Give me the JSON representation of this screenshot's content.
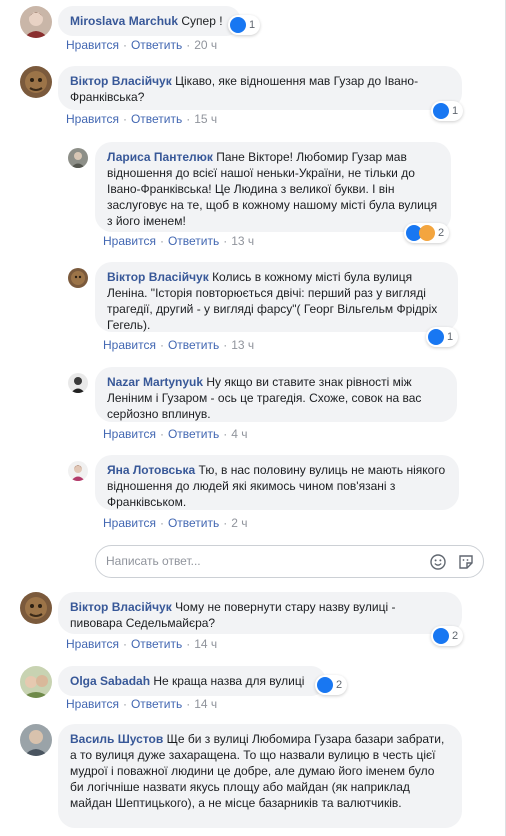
{
  "actions": {
    "like": "Нравится",
    "reply": "Ответить",
    "sep": "·"
  },
  "comments": [
    {
      "author": "Miroslava Marchuk",
      "text": "Супер !",
      "time": "20 ч",
      "reactions": "1"
    },
    {
      "author": "Віктор Власійчук",
      "text": "Цікаво, яке відношення мав Гузар до Івано-Франківська?",
      "time": "15 ч",
      "reactions": "1"
    },
    {
      "author": "Лариса Пантелюк",
      "text": "Пане Вікторе! Любомир Гузар мав відношення до всієї нашої неньки-України, не тільки до Івано-Франківська! Це Людина з великої букви. І він заслуговує на те, щоб в кожному нашому місті була вулиця з його іменем!",
      "time": "13 ч",
      "reactions": "2"
    },
    {
      "author": "Віктор Власійчук",
      "text": "Колись в кожному місті була вулиця Леніна. \"Історія повторюється двічі: перший раз у вигляді трагедії, другий - у вигляді фарсу\"( Георг Вільгельм Фрідріх Гегель).",
      "time": "13 ч",
      "reactions": "1"
    },
    {
      "author": "Nazar Martynyuk",
      "text": "Ну якщо ви ставите знак рівності між Леніним і Гузаром - ось це трагедія. Схоже, совок на вас серйозно вплинув.",
      "time": "4 ч",
      "reactions": ""
    },
    {
      "author": "Яна Лотовська",
      "text": "Тю, в нас половину вулиць не мають ніякого відношення до людей які якимось чином пов'язані з Франківськом.",
      "time": "2 ч",
      "reactions": ""
    },
    {
      "author": "Віктор Власійчук",
      "text": "Чому не повернути стару назву вулиці - пивовара Седельмайєра?",
      "time": "14 ч",
      "reactions": "2"
    },
    {
      "author": "Olga Sabadah",
      "text": "Не краща назва для вулиці",
      "time": "14 ч",
      "reactions": "2"
    },
    {
      "author": "Василь Шустов",
      "text": "Ще би з вулиці Любомира Гузара базари забрати, а то вулиця дуже захаращена. То що назвали вулицю в честь цієї мудрої і поважної людини це добре, але думаю його іменем було би логічніше назвати якусь площу або майдан (як наприклад майдан Шептицького), а не місце базарників та валютчиків.",
      "time": "",
      "reactions": ""
    }
  ],
  "reply_box": {
    "placeholder": "Написать ответ...",
    "emoji_icon": "smiley-icon",
    "sticker_icon": "sticker-icon"
  },
  "colors": {
    "author": "#385898",
    "link": "#4267b2",
    "bubble": "#f2f3f5",
    "like": "#1877f2",
    "muted": "#90949c"
  }
}
